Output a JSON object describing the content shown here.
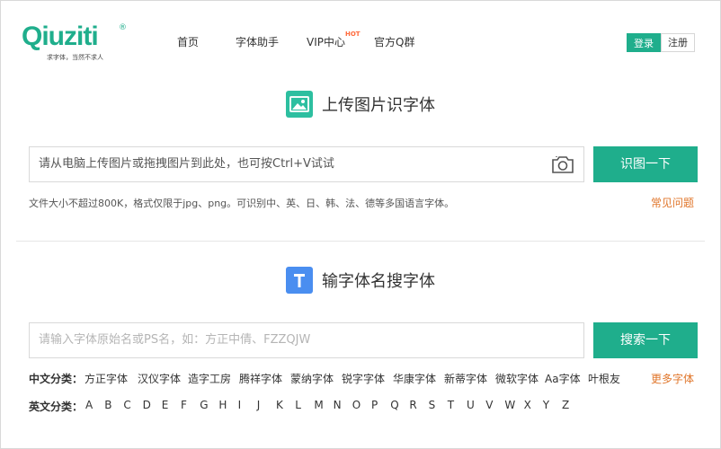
{
  "logo": {
    "text": "Qiuziti",
    "reg": "®",
    "slogan": "求字体，当然不求人"
  },
  "nav": {
    "items": [
      {
        "label": "首页"
      },
      {
        "label": "字体助手"
      },
      {
        "label": "VIP中心"
      },
      {
        "label": "官方Q群"
      }
    ],
    "hot_badge": "HOT"
  },
  "auth": {
    "login_label": "登录",
    "register_label": "注册"
  },
  "upload_section": {
    "title": "上传图片识字体",
    "input_text": "请从电脑上传图片或拖拽图片到此处，也可按Ctrl+V试试",
    "button_label": "识图一下",
    "hint": "文件大小不超过800K，格式仅限于jpg、png。可识别中、英、日、韩、法、德等多国语言字体。",
    "faq_label": "常见问题"
  },
  "search_section": {
    "title": "输字体名搜字体",
    "input_placeholder": "请输入字体原始名或PS名，如：方正中倩、FZZQJW",
    "button_label": "搜索一下",
    "chinese_label": "中文分类：",
    "chinese_categories": [
      "方正字体",
      "汉仪字体",
      "造字工房",
      "腾祥字体",
      "蒙纳字体",
      "锐字字体",
      "华康字体",
      "新蒂字体",
      "微软字体",
      "Aa字体",
      "叶根友"
    ],
    "more_label": "更多字体",
    "english_label": "英文分类：",
    "english_letters": [
      "A",
      "B",
      "C",
      "D",
      "E",
      "F",
      "G",
      "H",
      "I",
      "J",
      "K",
      "L",
      "M",
      "N",
      "O",
      "P",
      "Q",
      "R",
      "S",
      "T",
      "U",
      "V",
      "W",
      "X",
      "Y",
      "Z"
    ]
  },
  "colors": {
    "brand": "#1fae8c",
    "link_orange": "#e0762b",
    "hot": "#ff6a3c"
  }
}
